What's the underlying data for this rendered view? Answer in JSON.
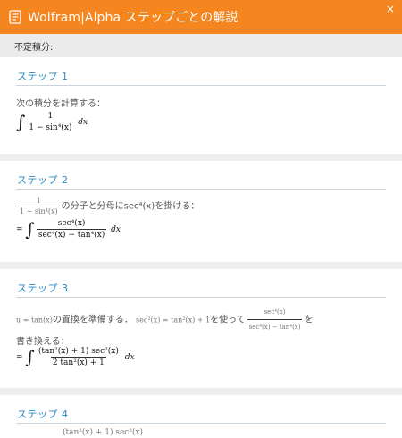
{
  "header": {
    "title": "Wolfram|Alpha ステップごとの解説",
    "close": "×",
    "logo_icon": "wolfram-doc-icon",
    "color": "#f5861f"
  },
  "subheader": {
    "label": "不定積分:"
  },
  "steps": [
    {
      "title": "ステップ 1",
      "text": "次の積分を計算する：",
      "num": "1",
      "den": "1 − sin⁴(x)",
      "dx": "dx"
    },
    {
      "title": "ステップ 2",
      "lead_num": "1",
      "lead_den": "1 − sin⁴(x)",
      "text": "の分子と分母にsec⁴(x)を掛ける：",
      "eq": "=",
      "num": "sec⁴(x)",
      "den": "sec⁴(x) − tan⁴(x)",
      "dx": "dx"
    },
    {
      "title": "ステップ 3",
      "sub": "u = tan(x)",
      "text_a": "の置換を準備する．",
      "identity": "sec²(x) = tan²(x) + 1",
      "text_b": "を使って",
      "lead_num": "sec⁴(x)",
      "lead_den": "sec⁴(x) − tan⁴(x)",
      "text_c": "を",
      "text_d": "書き換える：",
      "eq": "=",
      "num": "(tan²(x) + 1) sec²(x)",
      "den": "2 tan²(x) + 1",
      "dx": "dx"
    },
    {
      "title": "ステップ 4",
      "partial": "(tan²(x) + 1) sec²(x)"
    }
  ]
}
